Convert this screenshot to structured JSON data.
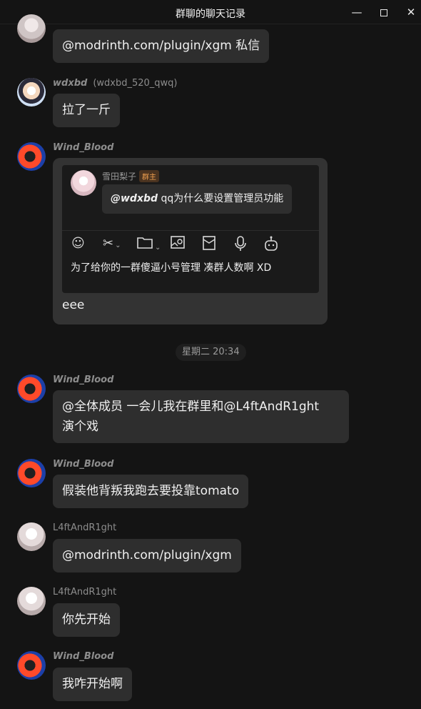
{
  "window": {
    "title": "群聊的聊天记录",
    "minimize": "—",
    "close": "✕"
  },
  "messages": {
    "m1": {
      "text": "@modrinth.com/plugin/xgm 私信"
    },
    "m2": {
      "name": "wdxbd",
      "qqid": "(wdxbd_520_qwq)",
      "text": "拉了一斤"
    },
    "m3": {
      "name": "Wind_Blood",
      "quote": {
        "author": "雪田梨子",
        "badge": "群主",
        "mention": "@wdxbd",
        "text": " qq为什么要设置管理员功能",
        "toolbar": [
          "smile-icon",
          "scissors-icon",
          "folder-icon",
          "image-icon",
          "envelope-icon",
          "microphone-icon",
          "robot-icon"
        ],
        "input_text": "为了给你的一群傻逼小号管理 凑群人数啊 XD"
      },
      "text": "eee"
    },
    "time_divider": "星期二 20:34",
    "m4": {
      "name": "Wind_Blood",
      "text_line1": "@全体成员 一会儿我在群里和@L4ftAndR1ght",
      "text_line2": "演个戏"
    },
    "m5": {
      "name": "Wind_Blood",
      "text": "假装他背叛我跑去要投靠tomato"
    },
    "m6": {
      "name": "L4ftAndR1ght",
      "text": "@modrinth.com/plugin/xgm"
    },
    "m7": {
      "name": "L4ftAndR1ght",
      "text": "你先开始"
    },
    "m8": {
      "name": "Wind_Blood",
      "text": "我咋开始啊"
    }
  }
}
